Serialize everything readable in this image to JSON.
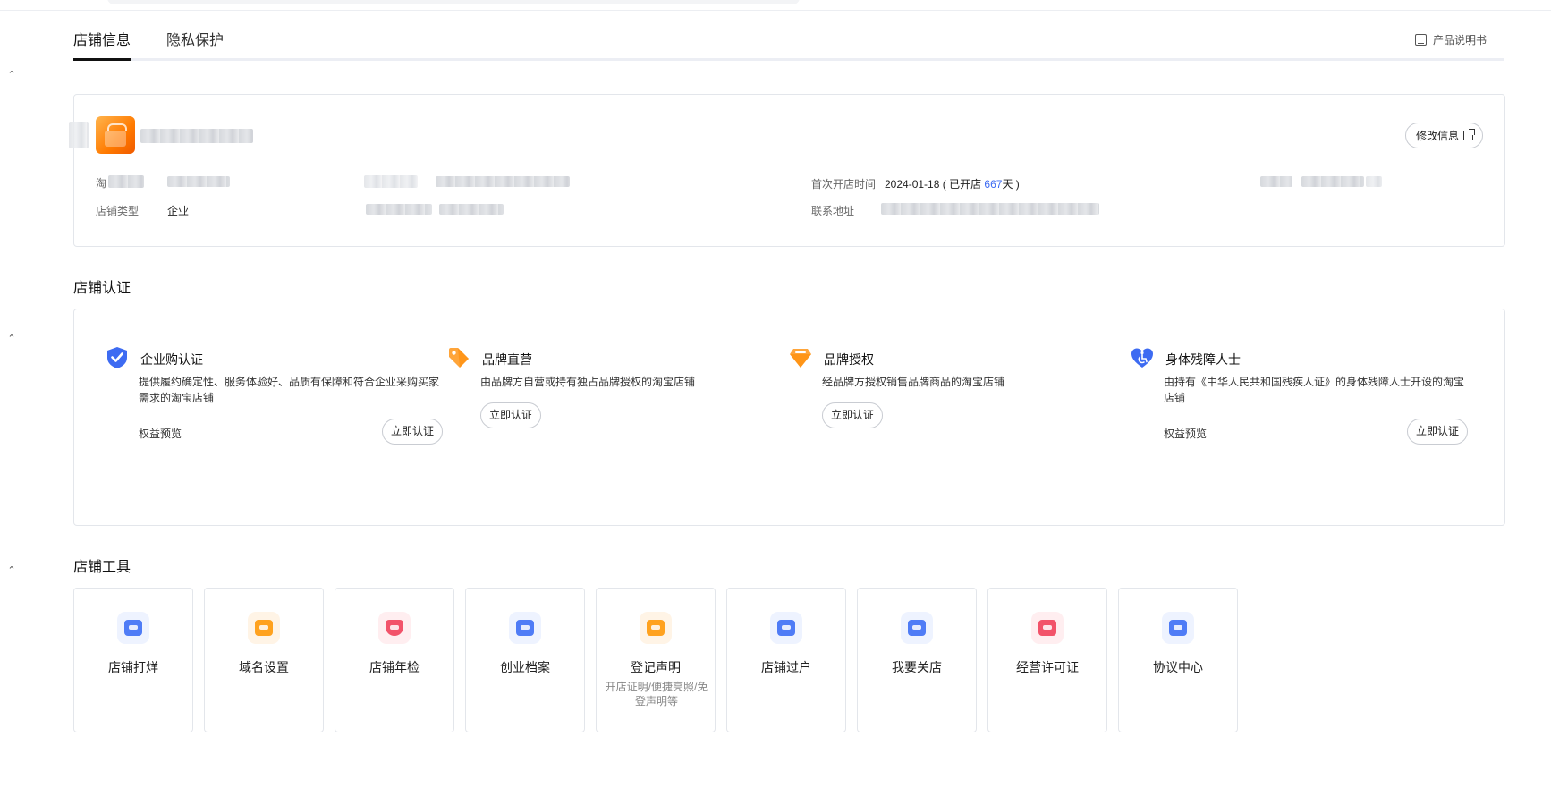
{
  "tabs": [
    {
      "label": "店铺信息",
      "active": true
    },
    {
      "label": "隐私保护",
      "active": false
    }
  ],
  "header": {
    "manual_label": "产品说明书"
  },
  "shop_info": {
    "edit_label": "修改信息",
    "fields": {
      "taobao_label": "淘",
      "shop_type_label": "店铺类型",
      "shop_type_value": "企业",
      "first_open_label": "首次开店时间",
      "first_open_date": "2024-01-18",
      "open_prefix": "( 已开店 ",
      "open_days": "667",
      "open_suffix": "天 )",
      "address_label": "联系地址"
    }
  },
  "certification": {
    "title": "店铺认证",
    "items": [
      {
        "name": "企业购认证",
        "desc": "提供履约确定性、服务体验好、品质有保障和符合企业采购买家需求的淘宝店铺",
        "benefit": "权益预览",
        "button": "立即认证",
        "icon": "shield-check-icon",
        "color": "#3d6bf2"
      },
      {
        "name": "品牌直营",
        "desc": "由品牌方自营或持有独占品牌授权的淘宝店铺",
        "benefit": "",
        "button": "立即认证",
        "icon": "tag-icon",
        "color": "#ff9a2e"
      },
      {
        "name": "品牌授权",
        "desc": "经品牌方授权销售品牌商品的淘宝店铺",
        "benefit": "",
        "button": "立即认证",
        "icon": "diamond-icon",
        "color": "#ff9a2e"
      },
      {
        "name": "身体残障人士",
        "desc": "由持有《中华人民共和国残疾人证》的身体残障人士开设的淘宝店铺",
        "benefit": "权益预览",
        "button": "立即认证",
        "icon": "heart-accessibility-icon",
        "color": "#3d6bf2"
      }
    ]
  },
  "tools": {
    "title": "店铺工具",
    "items": [
      {
        "name": "店铺打烊",
        "desc": "",
        "icon": "store-close-icon",
        "color": "#4f7cf6"
      },
      {
        "name": "域名设置",
        "desc": "",
        "icon": "domain-settings-icon",
        "color": "#ffa21f"
      },
      {
        "name": "店铺年检",
        "desc": "",
        "icon": "annual-check-icon",
        "color": "#f2536a"
      },
      {
        "name": "创业档案",
        "desc": "",
        "icon": "startup-archive-icon",
        "color": "#4f7cf6"
      },
      {
        "name": "登记声明",
        "desc": "开店证明/便捷亮照/免登声明等",
        "icon": "registration-statement-icon",
        "color": "#ffa21f"
      },
      {
        "name": "店铺过户",
        "desc": "",
        "icon": "shop-transfer-icon",
        "color": "#4f7cf6"
      },
      {
        "name": "我要关店",
        "desc": "",
        "icon": "close-shop-icon",
        "color": "#4f7cf6"
      },
      {
        "name": "经营许可证",
        "desc": "",
        "icon": "business-license-icon",
        "color": "#f2536a"
      },
      {
        "name": "协议中心",
        "desc": "",
        "icon": "agreement-center-icon",
        "color": "#4f7cf6"
      }
    ]
  }
}
